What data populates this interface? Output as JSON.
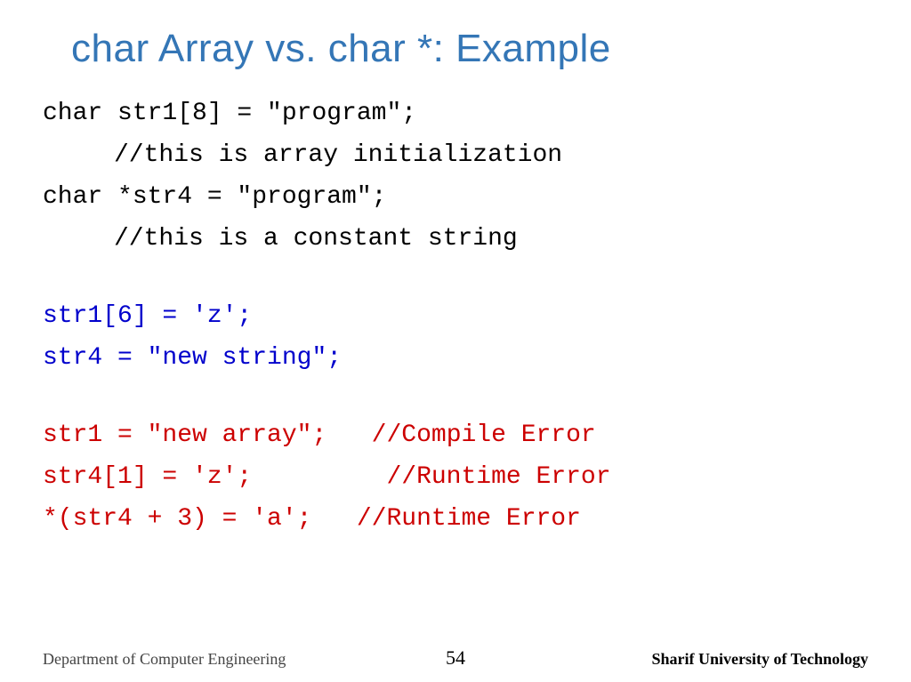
{
  "title": "char Array vs. char *: Example",
  "code": {
    "l1": "char str1[8] = \"program\";",
    "l2": "//this is array initialization",
    "l3": "char *str4 = \"program\";",
    "l4": "//this is a constant string",
    "l5": "str1[6] = 'z';",
    "l6": "str4 = \"new string\";",
    "l7a": "str1 = \"new array\";",
    "l7b": "   //Compile ",
    "l7err": "Error",
    "l8a": "str4[1] = 'z';",
    "l8b": "         //Runtime ",
    "l8err": "Error",
    "l9a": "*(str4 + 3) = 'a';",
    "l9b": "   //Runtime ",
    "l9err": "Error"
  },
  "footer": {
    "dept": "Department of Computer Engineering",
    "page": "54",
    "uni": "Sharif University of Technology"
  }
}
